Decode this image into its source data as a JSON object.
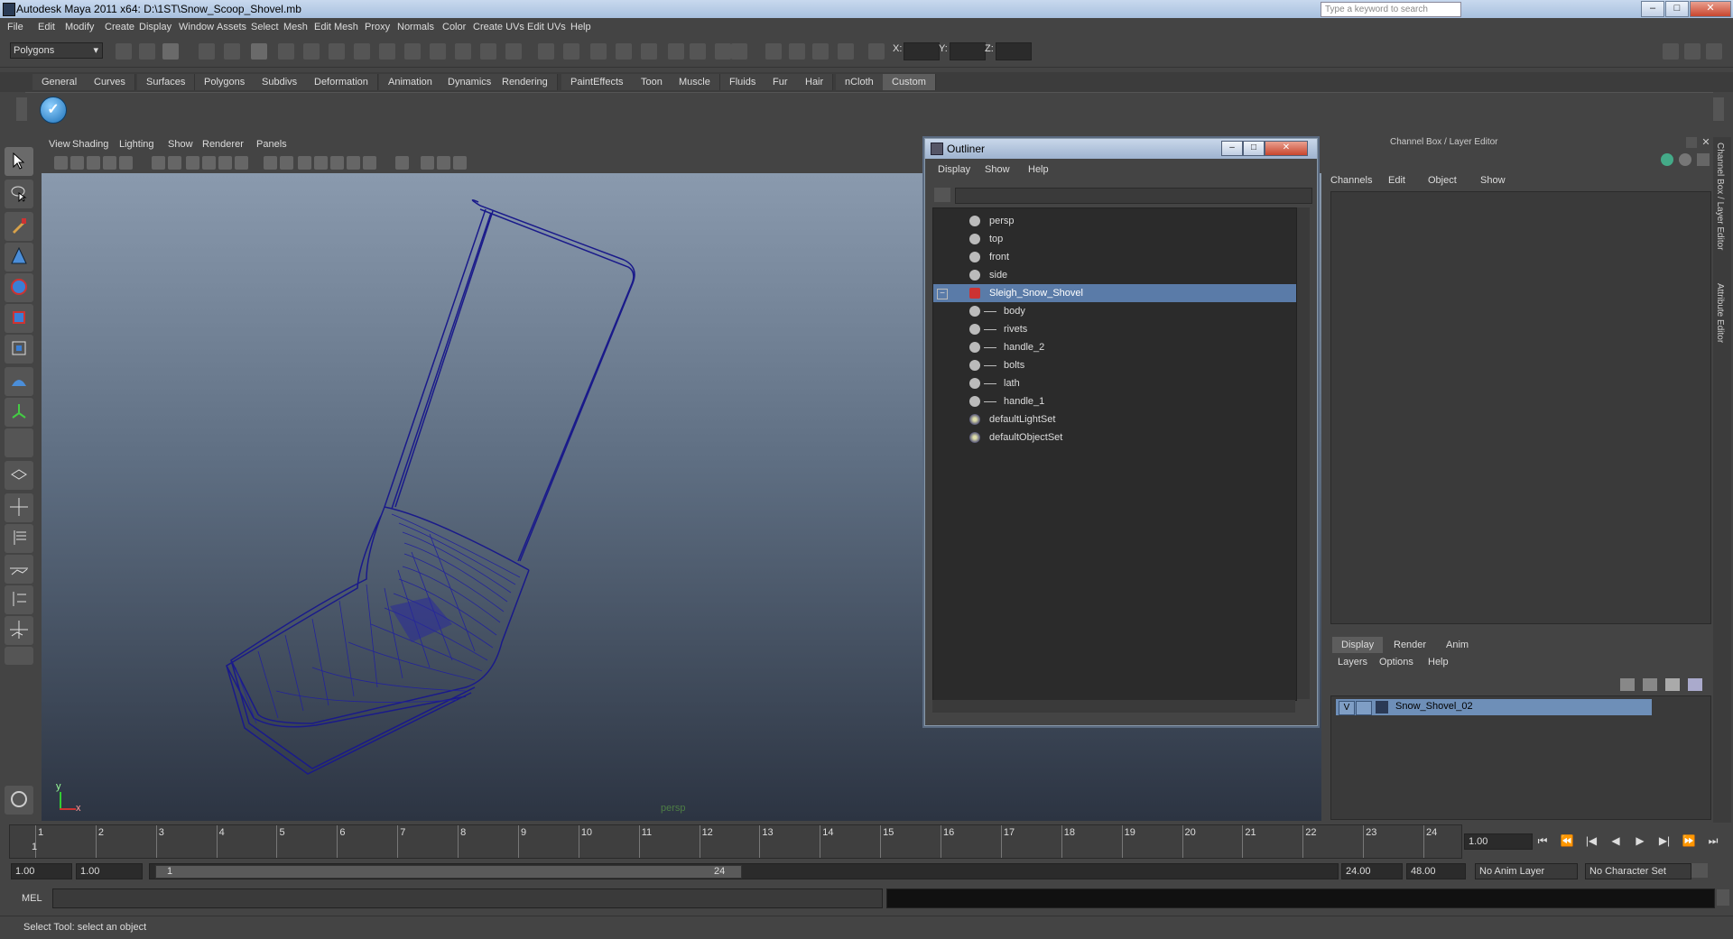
{
  "window": {
    "title": "Autodesk Maya 2011 x64: D:\\1ST\\Snow_Scoop_Shovel.mb",
    "search_placeholder": "Type a keyword to search",
    "minimize": "–",
    "maximize": "□",
    "close": "✕"
  },
  "menubar": [
    "File",
    "Edit",
    "Modify",
    "Create",
    "Display",
    "Window",
    "Assets",
    "Select",
    "Mesh",
    "Edit Mesh",
    "Proxy",
    "Normals",
    "Color",
    "Create UVs",
    "Edit UVs",
    "Help"
  ],
  "statusline": {
    "mode": "Polygons",
    "x_label": "X:",
    "y_label": "Y:",
    "z_label": "Z:"
  },
  "shelf": {
    "tabs": [
      "General",
      "Curves",
      "Surfaces",
      "Polygons",
      "Subdivs",
      "Deformation",
      "Animation",
      "Dynamics",
      "Rendering",
      "PaintEffects",
      "Toon",
      "Muscle",
      "Fluids",
      "Fur",
      "Hair",
      "nCloth",
      "Custom"
    ],
    "active_tab": "Custom",
    "check_glyph": "✓"
  },
  "viewport": {
    "menu": [
      "View",
      "Shading",
      "Lighting",
      "Show",
      "Renderer",
      "Panels"
    ],
    "camera_label": "persp",
    "axis_y": "y",
    "axis_x": "x"
  },
  "outliner": {
    "title": "Outliner",
    "menu": [
      "Display",
      "Show",
      "Help"
    ],
    "expand_glyph": "−",
    "items": [
      {
        "label": "persp",
        "dim": true,
        "indent": 0
      },
      {
        "label": "top",
        "dim": true,
        "indent": 0
      },
      {
        "label": "front",
        "dim": true,
        "indent": 0
      },
      {
        "label": "side",
        "dim": true,
        "indent": 0
      },
      {
        "label": "Sleigh_Snow_Shovel",
        "selected": true,
        "indent": 0
      },
      {
        "label": "body",
        "indent": 1
      },
      {
        "label": "rivets",
        "indent": 1
      },
      {
        "label": "handle_2",
        "indent": 1
      },
      {
        "label": "bolts",
        "indent": 1
      },
      {
        "label": "lath",
        "indent": 1
      },
      {
        "label": "handle_1",
        "indent": 1
      },
      {
        "label": "defaultLightSet",
        "indent": 0,
        "set": true
      },
      {
        "label": "defaultObjectSet",
        "indent": 0,
        "set": true
      }
    ]
  },
  "channelbox": {
    "title": "Channel Box / Layer Editor",
    "menu": [
      "Channels",
      "Edit",
      "Object",
      "Show"
    ],
    "layer_tabs": [
      "Display",
      "Render",
      "Anim"
    ],
    "active_layer_tab": "Display",
    "layer_menu": [
      "Layers",
      "Options",
      "Help"
    ],
    "layer_name": "Snow_Shovel_02",
    "layer_visible": "V",
    "side_tabs": [
      "Channel Box / Layer Editor",
      "Attribute Editor"
    ]
  },
  "timeline": {
    "frames": [
      1,
      2,
      3,
      4,
      5,
      6,
      7,
      8,
      9,
      10,
      11,
      12,
      13,
      14,
      15,
      16,
      17,
      18,
      19,
      20,
      21,
      22,
      23,
      24
    ],
    "current_frame_marker": "1",
    "current_time": "1.00",
    "playback": [
      "⏮",
      "⏪",
      "|◀",
      "◀",
      "▶",
      "▶|",
      "⏩",
      "⏭"
    ]
  },
  "range": {
    "start": "1.00",
    "playback_start": "1.00",
    "slider_start": "1",
    "slider_end": "24",
    "playback_end": "24.00",
    "end": "48.00",
    "anim_layer": "No Anim Layer",
    "character_set": "No Character Set"
  },
  "commandline": {
    "label": "MEL"
  },
  "helpline": {
    "text": "Select Tool: select an object"
  }
}
